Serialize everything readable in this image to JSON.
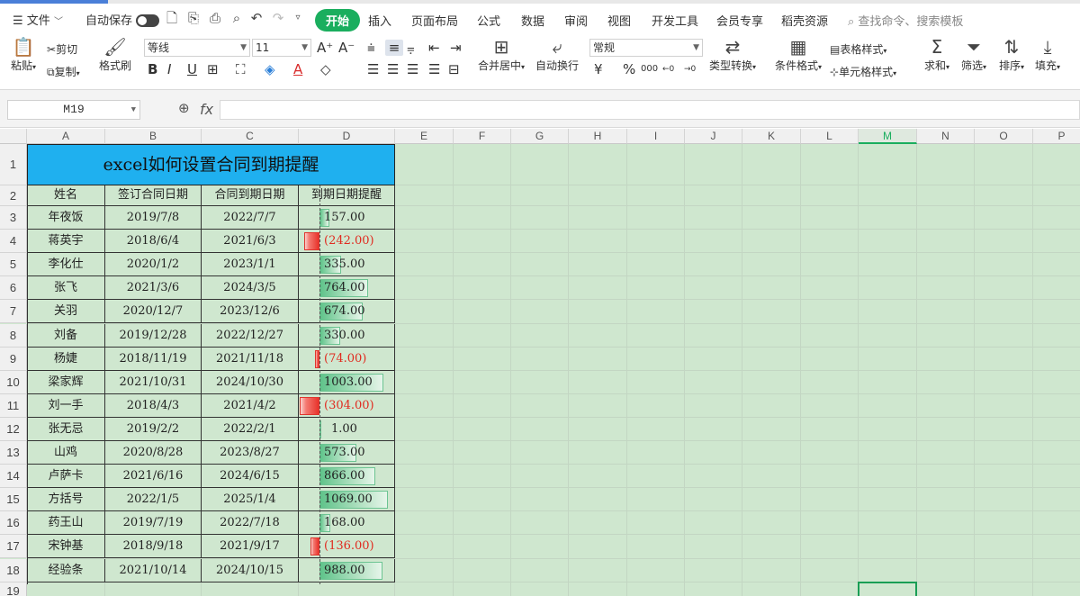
{
  "menubar": {
    "file_label": "文件",
    "autosave_label": "自动保存",
    "tabs": [
      "开始",
      "插入",
      "页面布局",
      "公式",
      "数据",
      "审阅",
      "视图",
      "开发工具",
      "会员专享",
      "稻壳资源"
    ],
    "search_placeholder": "查找命令、搜索模板"
  },
  "ribbon": {
    "paste": "粘贴",
    "cut": "剪切",
    "copy": "复制",
    "format_painter": "格式刷",
    "font_name": "等线",
    "font_size": "11",
    "merge_center": "合并居中",
    "wrap_text": "自动换行",
    "number_format": "常规",
    "type_convert": "类型转换",
    "conditional_format": "条件格式",
    "table_style": "表格样式",
    "cell_style": "单元格样式",
    "sum": "求和",
    "filter": "筛选",
    "sort": "排序",
    "fill": "填充"
  },
  "formula_bar": {
    "name_box": "M19",
    "formula": ""
  },
  "columns": [
    "A",
    "B",
    "C",
    "D",
    "E",
    "F",
    "G",
    "H",
    "I",
    "J",
    "K",
    "L",
    "M",
    "N",
    "O",
    "P"
  ],
  "active_column": "M",
  "rows": [
    "1",
    "2",
    "3",
    "4",
    "5",
    "6",
    "7",
    "8",
    "9",
    "10",
    "11",
    "12",
    "13",
    "14",
    "15",
    "16",
    "17",
    "18",
    "19"
  ],
  "sheet": {
    "title": "excel如何设置合同到期提醒",
    "headers": [
      "姓名",
      "签订合同日期",
      "合同到期日期",
      "到期日期提醒"
    ],
    "records": [
      {
        "name": "年夜饭",
        "sign": "2019/7/8",
        "expire": "2022/7/7",
        "remind": "157.00",
        "value": 157
      },
      {
        "name": "蒋英宇",
        "sign": "2018/6/4",
        "expire": "2021/6/3",
        "remind": "(242.00)",
        "value": -242
      },
      {
        "name": "李化仕",
        "sign": "2020/1/2",
        "expire": "2023/1/1",
        "remind": "335.00",
        "value": 335
      },
      {
        "name": "张飞",
        "sign": "2021/3/6",
        "expire": "2024/3/5",
        "remind": "764.00",
        "value": 764
      },
      {
        "name": "关羽",
        "sign": "2020/12/7",
        "expire": "2023/12/6",
        "remind": "674.00",
        "value": 674
      },
      {
        "name": "刘备",
        "sign": "2019/12/28",
        "expire": "2022/12/27",
        "remind": "330.00",
        "value": 330
      },
      {
        "name": "杨婕",
        "sign": "2018/11/19",
        "expire": "2021/11/18",
        "remind": "(74.00)",
        "value": -74
      },
      {
        "name": "梁家辉",
        "sign": "2021/10/31",
        "expire": "2024/10/30",
        "remind": "1003.00",
        "value": 1003
      },
      {
        "name": "刘一手",
        "sign": "2018/4/3",
        "expire": "2021/4/2",
        "remind": "(304.00)",
        "value": -304
      },
      {
        "name": "张无忌",
        "sign": "2019/2/2",
        "expire": "2022/2/1",
        "remind": "1.00",
        "value": 1
      },
      {
        "name": "山鸡",
        "sign": "2020/8/28",
        "expire": "2023/8/27",
        "remind": "573.00",
        "value": 573
      },
      {
        "name": "卢萨卡",
        "sign": "2021/6/16",
        "expire": "2024/6/15",
        "remind": "866.00",
        "value": 866
      },
      {
        "name": "方括号",
        "sign": "2022/1/5",
        "expire": "2025/1/4",
        "remind": "1069.00",
        "value": 1069
      },
      {
        "name": "药王山",
        "sign": "2019/7/19",
        "expire": "2022/7/18",
        "remind": "168.00",
        "value": 168
      },
      {
        "name": "宋钟基",
        "sign": "2018/9/18",
        "expire": "2021/9/17",
        "remind": "(136.00)",
        "value": -136
      },
      {
        "name": "经验条",
        "sign": "2021/10/14",
        "expire": "2024/10/15",
        "remind": "988.00",
        "value": 988
      }
    ]
  },
  "colors": {
    "title_fill": "#1fb0ef",
    "grid_fill": "#cfe7cf",
    "accent": "#1aae5e",
    "negative_text": "#e02b20"
  }
}
